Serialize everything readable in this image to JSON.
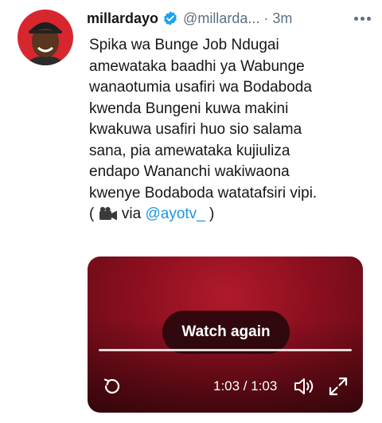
{
  "tweet": {
    "display_name": "millardayo",
    "handle": "@millarda...",
    "separator": "·",
    "time": "3m",
    "text_lines": [
      "Spika wa Bunge Job Ndugai",
      "amewataka baadhi ya Wabunge",
      "wanaotumia usafiri wa Bodaboda",
      "kwenda Bungeni kuwa makini",
      "kwakuwa usafiri huo sio salama",
      "sana, pia amewataka kujiuliza",
      "endapo Wananchi wakiwaona",
      "kwenye Bodaboda watatafsiri vipi."
    ],
    "last_line": {
      "open": "(",
      "via": "via",
      "mention": "@ayotv_",
      "close": ")"
    }
  },
  "video": {
    "watch_again_label": "Watch again",
    "time_readout": "1:03 / 1:03",
    "progress": 1.0
  },
  "icons": {
    "verified": "verified-badge-icon",
    "more": "more-options-icon",
    "camera": "video-camera-icon",
    "replay": "replay-icon",
    "volume": "volume-icon",
    "fullscreen": "fullscreen-icon"
  },
  "colors": {
    "link": "#1b95e0",
    "secondary_text": "#5b7083",
    "verified": "#1da1f2",
    "video_bg": "#8c0f1f"
  }
}
